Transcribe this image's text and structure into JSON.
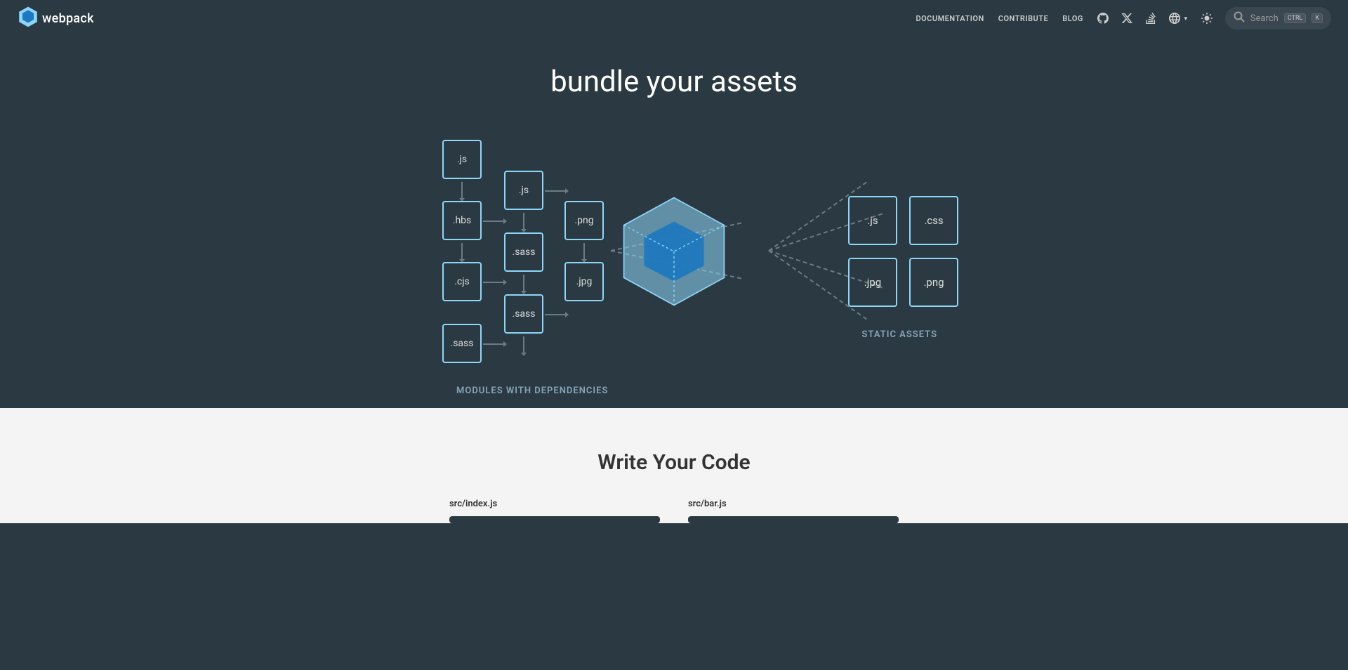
{
  "header": {
    "logo_text": "webpack",
    "nav": {
      "documentation": "DOCUMENTATION",
      "contribute": "CONTRIBUTE",
      "blog": "BLOG"
    },
    "search": {
      "placeholder": "Search",
      "kbd_ctrl": "CTRL",
      "kbd_k": "K"
    }
  },
  "hero": {
    "word1": "bundle",
    "word2": "your",
    "word3": "assets"
  },
  "diagram": {
    "modules": {
      "js1": ".js",
      "js2": ".js",
      "png": ".png",
      "hbs": ".hbs",
      "sass1": ".sass",
      "cjs": ".cjs",
      "jpg": ".jpg",
      "sass2": ".sass",
      "sass3": ".sass"
    },
    "outputs": {
      "js": ".js",
      "css": ".css",
      "jpg": ".jpg",
      "png": ".png"
    },
    "label_left": "MODULES WITH DEPENDENCIES",
    "label_right": "STATIC ASSETS"
  },
  "write": {
    "title": "Write Your Code",
    "file1": "src/index.js",
    "file2": "src/bar.js"
  }
}
